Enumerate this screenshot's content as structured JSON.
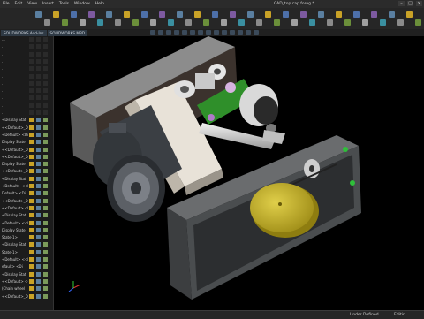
{
  "menubar": {
    "items": [
      "File",
      "Edit",
      "View",
      "Insert",
      "Tools",
      "Window",
      "Help"
    ],
    "document_title": "CAD_top cap foreg *"
  },
  "tabs": [
    "SOLIDWORKS Add-Ins",
    "SOLIDWORKS MBD"
  ],
  "tree_rows": [
    "...",
    ".",
    ".",
    ".",
    ".",
    ".",
    ".",
    ".",
    ".",
    ".",
    ".",
    "<Display Stat",
    "<<Default>_Di",
    "<Default> <Di",
    "Display State",
    "<<Default>_Di",
    "<<Default>_Di",
    "Display State",
    "<<Default>_Di",
    "<Display Stat",
    "<Default> <<D",
    "Default> <Di",
    "<<Default>_Di",
    "<<Default> <Di",
    "<Display Stat",
    "<Default> <<D",
    "Display State",
    "State-1>",
    "<Display Stat",
    "State-1>",
    "<Default> <<D",
    "efault> <Di",
    "<Display Stat",
    "<<Default> <<D",
    "(Chain wheel",
    "<<Default>_Di"
  ],
  "status": {
    "state": "Under Defined",
    "editing": "Editin"
  },
  "colors": {
    "background": "#000000",
    "panel": "#1c1c1c",
    "housing": "#4a4d4f",
    "motor": "#3b3f44",
    "pulley": "#c8b425",
    "shaft": "#d9d9d9",
    "accent_green": "#2f8f2a"
  },
  "icons": [
    "close-icon",
    "minimize-icon",
    "maximize-icon",
    "triad-icon",
    "search-icon"
  ]
}
